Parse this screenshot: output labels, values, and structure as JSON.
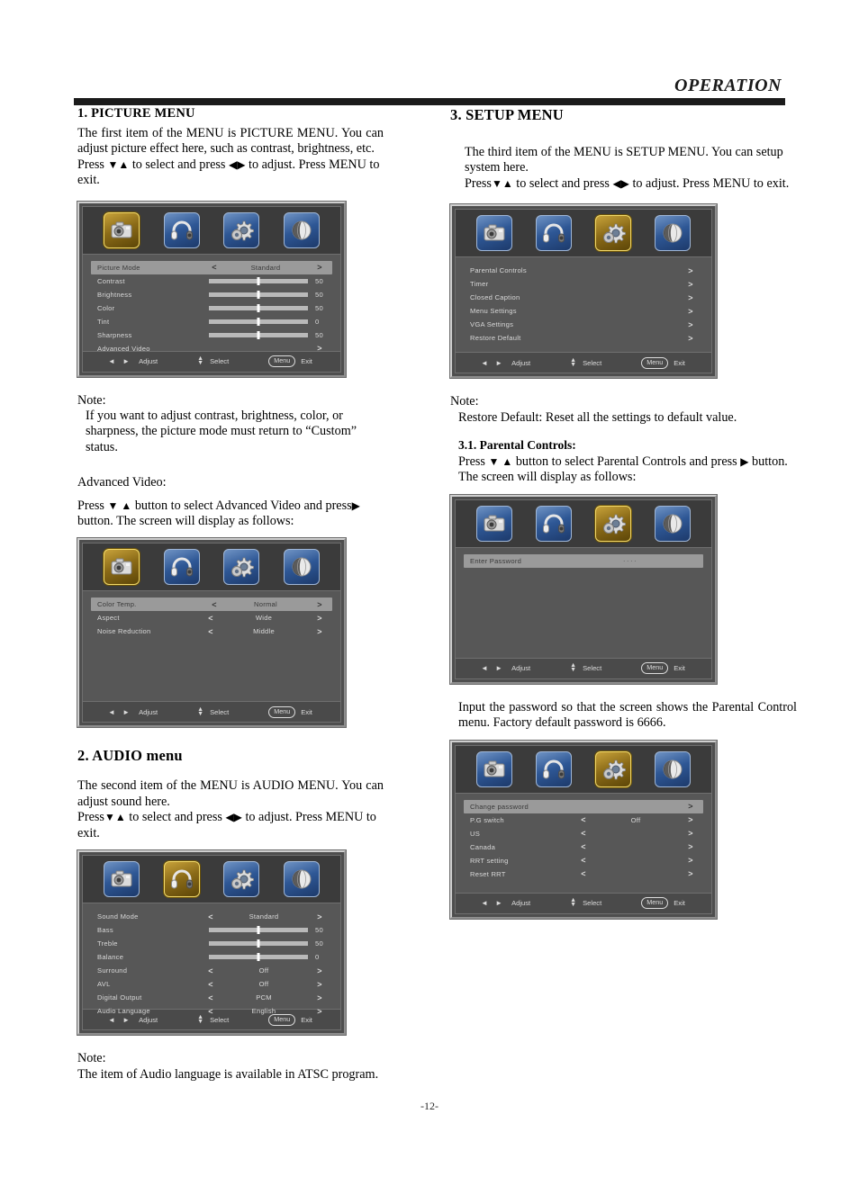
{
  "header": {
    "title": "OPERATION"
  },
  "page_number": "-12-",
  "left": {
    "s1": {
      "heading": "1. PICTURE MENU",
      "p1": "The first item of the MENU is PICTURE MENU. You can adjust picture effect here, such as contrast, brightness, etc.",
      "p2_a": "Press",
      "p2_b": "to select and press",
      "p2_c": "to adjust. Press MENU to exit.",
      "down_up": "▼▲",
      "left_right": "◀▶"
    },
    "note1": {
      "title": "Note:",
      "text": "If you want to adjust contrast, brightness, color, or sharpness, the picture mode must return to “Custom” status."
    },
    "advanced": {
      "title": "Advanced Video:",
      "line_a": "Press",
      "down_up": "▼ ▲",
      "line_b": "button to select  Advanced Video and press",
      "right_arrow": "▶",
      "line_c": "button.  The screen will  display as follows:"
    },
    "s2": {
      "heading": "2. AUDIO menu",
      "p1": "The second item of the MENU is AUDIO MENU. You can adjust sound here.",
      "p2_a": "Press",
      "p2_b": "to select and press",
      "p2_c": "to adjust. Press MENU to exit.",
      "down_up": "▼▲",
      "left_right": "◀▶"
    },
    "note2": {
      "title": "Note:",
      "text": "The item of Audio language is available in ATSC program."
    }
  },
  "right": {
    "s3": {
      "heading": "3.  SETUP   MENU",
      "p1": "The third item of the MENU is SETUP MENU. You can setup system here.",
      "p2_a": "Press",
      "p2_b": "to select and press",
      "p2_c": "to adjust. Press MENU to exit.",
      "down_up": "▼▲",
      "left_right": "◀▶"
    },
    "note3": {
      "title": "Note:",
      "text": "Restore Default: Reset all the settings to default value."
    },
    "s31": {
      "heading": "3.1. Parental Controls:",
      "line_a": "Press",
      "down_up": "▼ ▲",
      "line_b": "button to select  Parental Controls and press",
      "right_arrow": "▶",
      "line_c": "button. The screen will  display as follows:"
    },
    "pwd_note": "Input the password so that the screen shows the Parental Control menu. Factory default password is 6666."
  },
  "osd_footer": {
    "adjust_label": "Adjust",
    "select_label": "Select",
    "menu_label": "Menu",
    "exit_label": "Exit",
    "lr_arrows": "◄ ►",
    "up": "▲",
    "down": "▼"
  },
  "icons": {
    "picture": "camera-icon",
    "audio": "headphones-icon",
    "setup": "gear-icon",
    "channel": "globe-icon"
  },
  "menus": {
    "picture": {
      "active_tab": 0,
      "rows": [
        {
          "label": "Picture Mode",
          "type": "option",
          "value": "Standard",
          "selected": true
        },
        {
          "label": "Contrast",
          "type": "slider",
          "value": "50",
          "pos": 50
        },
        {
          "label": "Brightness",
          "type": "slider",
          "value": "50",
          "pos": 50
        },
        {
          "label": "Color",
          "type": "slider",
          "value": "50",
          "pos": 50
        },
        {
          "label": "Tint",
          "type": "slider",
          "value": "0",
          "pos": 50
        },
        {
          "label": "Sharpness",
          "type": "slider",
          "value": "50",
          "pos": 50
        },
        {
          "label": "Advanced Video",
          "type": "submenu"
        }
      ]
    },
    "advanced_video": {
      "active_tab": 0,
      "rows": [
        {
          "label": "Color Temp.",
          "type": "option",
          "value": "Normal",
          "selected": true
        },
        {
          "label": "Aspect",
          "type": "option",
          "value": "Wide"
        },
        {
          "label": "Noise Reduction",
          "type": "option",
          "value": "Middle"
        }
      ]
    },
    "audio": {
      "active_tab": 1,
      "rows": [
        {
          "label": "Sound  Mode",
          "type": "option",
          "value": "Standard"
        },
        {
          "label": "Bass",
          "type": "slider",
          "value": "50",
          "pos": 50
        },
        {
          "label": "Treble",
          "type": "slider",
          "value": "50",
          "pos": 50
        },
        {
          "label": "Balance",
          "type": "slider",
          "value": "0",
          "pos": 50
        },
        {
          "label": "Surround",
          "type": "option",
          "value": "Off"
        },
        {
          "label": "AVL",
          "type": "option",
          "value": "Off"
        },
        {
          "label": "Digital Output",
          "type": "option",
          "value": "PCM"
        },
        {
          "label": "Audio Language",
          "type": "option",
          "value": "English"
        }
      ]
    },
    "setup": {
      "active_tab": 2,
      "rows": [
        {
          "label": "Parental Controls",
          "type": "submenu"
        },
        {
          "label": "Timer",
          "type": "submenu"
        },
        {
          "label": "Closed Caption",
          "type": "submenu"
        },
        {
          "label": "Menu Settings",
          "type": "submenu"
        },
        {
          "label": "VGA Settings",
          "type": "submenu"
        },
        {
          "label": "Restore Default",
          "type": "submenu"
        }
      ]
    },
    "password": {
      "active_tab": 2,
      "rows": [
        {
          "label": "Enter Password",
          "type": "password",
          "value": "····",
          "selected": true
        }
      ]
    },
    "parental": {
      "active_tab": 2,
      "rows": [
        {
          "label": "Change password",
          "type": "submenu",
          "selected": true
        },
        {
          "label": "P.G switch",
          "type": "option",
          "value": "Off"
        },
        {
          "label": "US",
          "type": "option",
          "value": ""
        },
        {
          "label": "Canada",
          "type": "option",
          "value": ""
        },
        {
          "label": "RRT setting",
          "type": "option",
          "value": ""
        },
        {
          "label": "Reset  RRT",
          "type": "option",
          "value": ""
        }
      ]
    }
  }
}
